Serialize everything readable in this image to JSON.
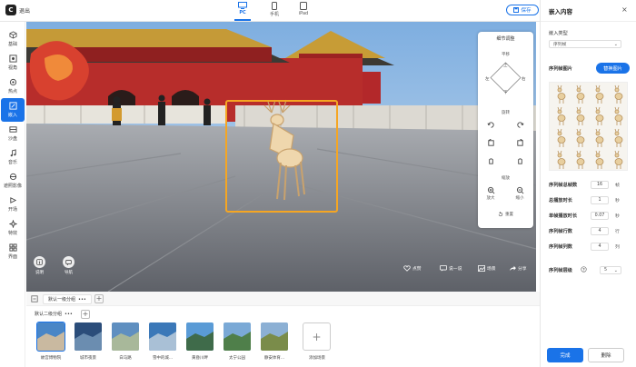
{
  "topbar": {
    "exit_label": "退出",
    "logo_letter": "C",
    "devices": [
      {
        "label": "PC",
        "active": true
      },
      {
        "label": "手机",
        "active": false
      },
      {
        "label": "iPad",
        "active": false
      }
    ],
    "save_label": "保存"
  },
  "sidebar": {
    "items": [
      {
        "label": "基础",
        "icon": "cube-icon"
      },
      {
        "label": "视角",
        "icon": "eye-icon"
      },
      {
        "label": "热点",
        "icon": "hotspot-icon"
      },
      {
        "label": "嵌入",
        "icon": "embed-icon",
        "active": true
      },
      {
        "label": "沙盘",
        "icon": "sandbox-icon"
      },
      {
        "label": "音乐",
        "icon": "music-icon"
      },
      {
        "label": "遮照影像",
        "icon": "mask-icon"
      },
      {
        "label": "开场",
        "icon": "opening-icon"
      },
      {
        "label": "特效",
        "icon": "effects-icon"
      },
      {
        "label": "界面",
        "icon": "interface-icon"
      }
    ]
  },
  "view_panel": {
    "title": "细节调整",
    "pan_label": "平移",
    "dir_up": "上",
    "dir_down": "下",
    "dir_left": "左",
    "dir_right": "右",
    "rotate_label": "旋转",
    "zoom_label": "缩放",
    "zoom_in": "放大",
    "zoom_out": "缩小",
    "reset": "重置"
  },
  "stage": {
    "left_buttons": [
      {
        "label": "说明",
        "icon": "info-icon"
      },
      {
        "label": "导航",
        "icon": "map-icon"
      }
    ],
    "actions": [
      {
        "label": "点赞",
        "icon": "heart-icon"
      },
      {
        "label": "说一说",
        "icon": "comment-icon"
      },
      {
        "label": "场景",
        "icon": "scene-icon"
      },
      {
        "label": "分享",
        "icon": "share-icon"
      }
    ]
  },
  "scenes": {
    "group_tab": "默认一级分组",
    "sub_tab": "默认二级分组",
    "menu_dots": "•••",
    "add": "+",
    "items": [
      {
        "label": "故宫博物院",
        "selected": true,
        "colors": [
          "#4a86c6",
          "#c9b9a0"
        ]
      },
      {
        "label": "城市夜景",
        "colors": [
          "#2b4d7a",
          "#6b8db0"
        ]
      },
      {
        "label": "白马路",
        "colors": [
          "#5f8fc0",
          "#a8b89a"
        ]
      },
      {
        "label": "雪中的城...",
        "colors": [
          "#3b78b8",
          "#a9c0d6"
        ]
      },
      {
        "label": "黄昏川畔",
        "colors": [
          "#5a9bd6",
          "#3f6b4a"
        ]
      },
      {
        "label": "太宁公园",
        "colors": [
          "#7aa9d6",
          "#4f7f4a"
        ]
      },
      {
        "label": "静安体育...",
        "colors": [
          "#8cb0d4",
          "#7a8c4a"
        ]
      }
    ],
    "add_scene": "添加场景"
  },
  "right_panel": {
    "title": "嵌入内容",
    "close": "×",
    "embed_type_label": "嵌入类型",
    "embed_type_value": "序列帧",
    "seq_image_label": "序列帧图片",
    "replace_btn": "替换图片",
    "fields": [
      {
        "label": "序列帧总帧数",
        "value": "16",
        "unit": "帧"
      },
      {
        "label": "总播放时长",
        "value": "1",
        "unit": "秒"
      },
      {
        "label": "单帧播放时长",
        "value": "0.07",
        "unit": "秒"
      },
      {
        "label": "序列帧行数",
        "value": "4",
        "unit": "行"
      },
      {
        "label": "序列帧列数",
        "value": "4",
        "unit": "列"
      }
    ],
    "level_label": "序列帧层级",
    "level_value": "5",
    "done": "完成",
    "delete": "删除"
  }
}
